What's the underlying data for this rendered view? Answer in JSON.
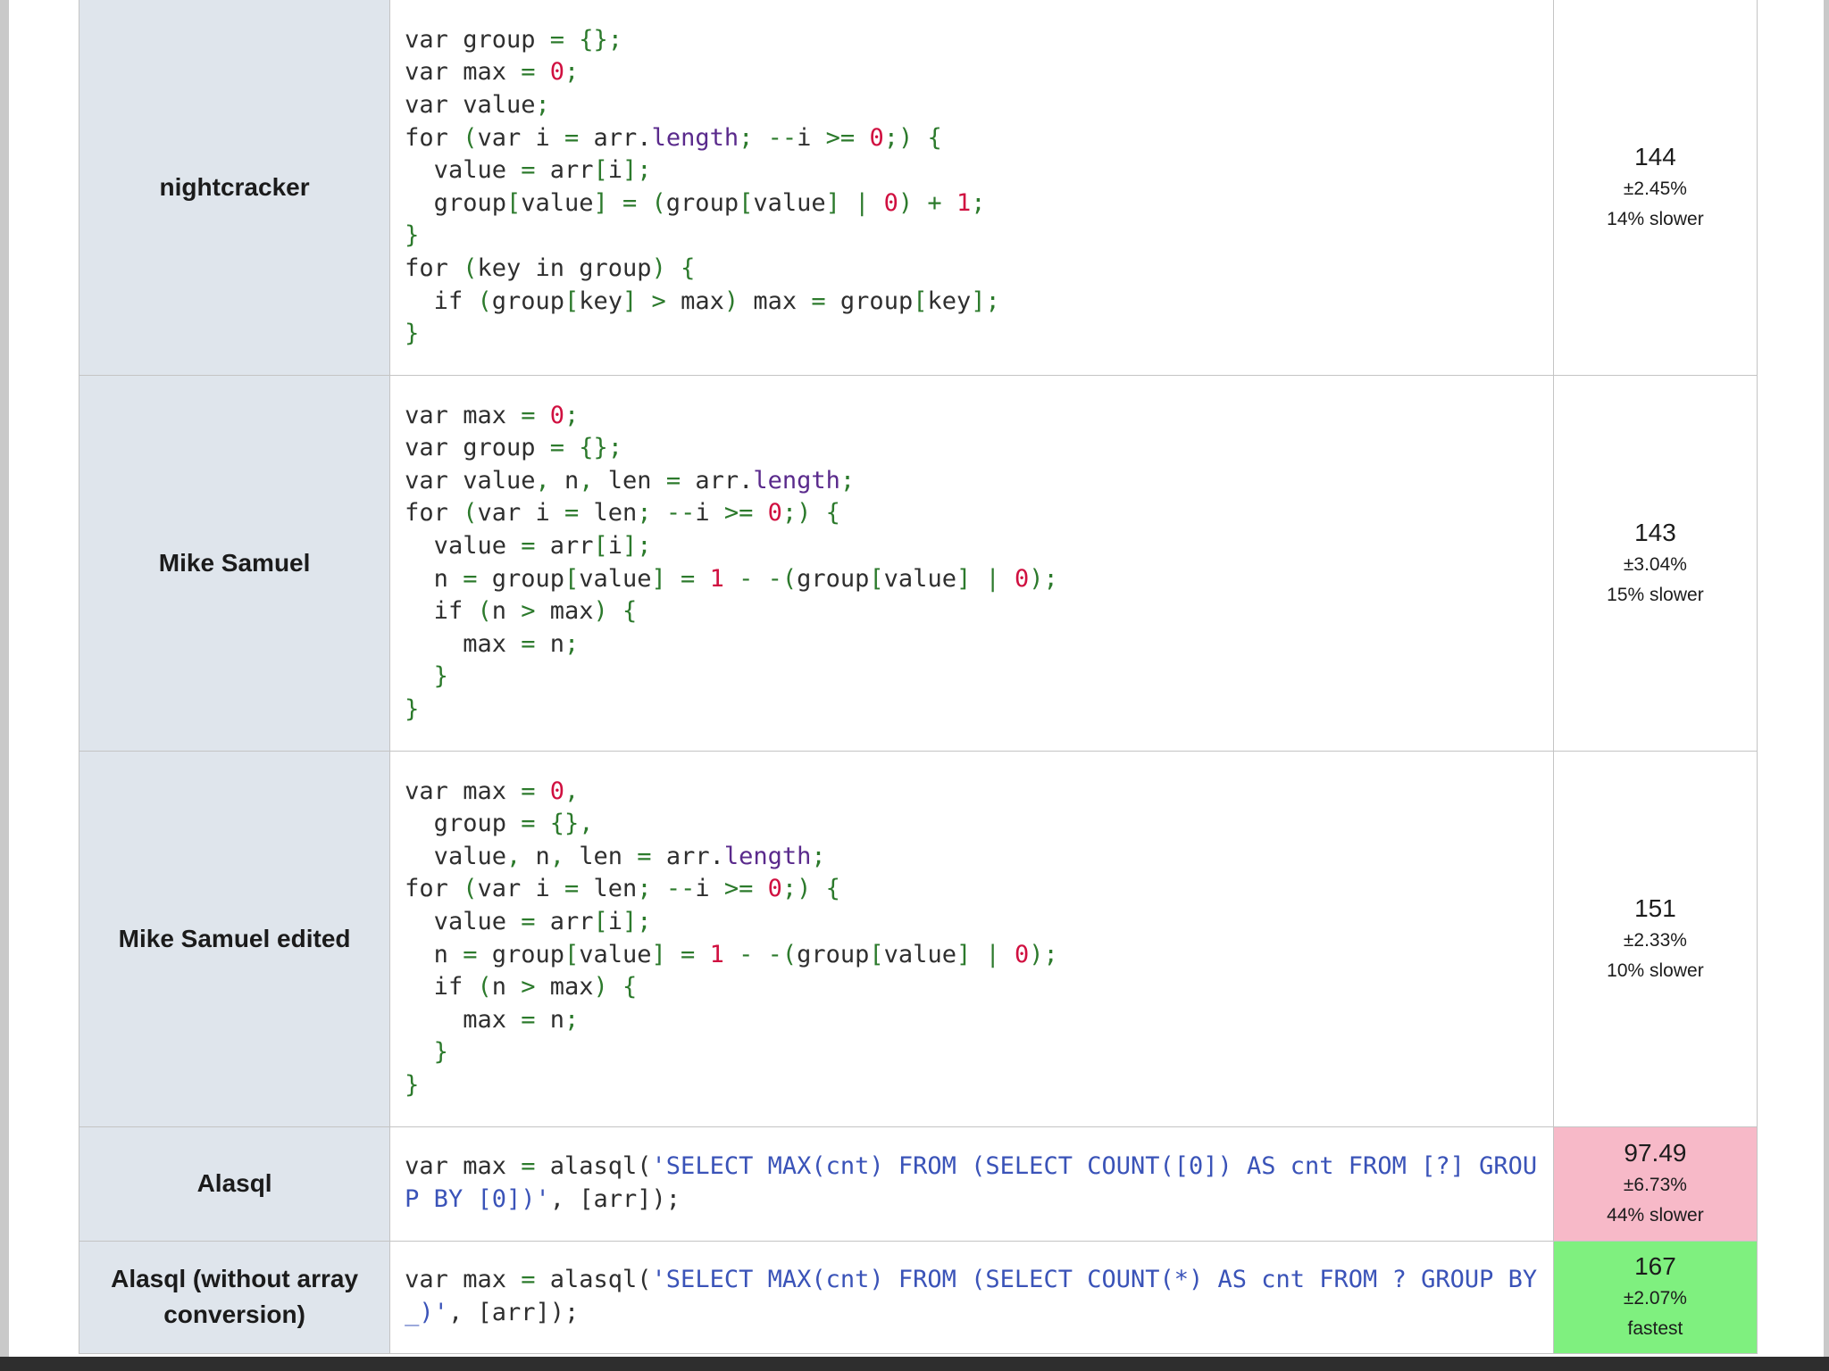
{
  "colors": {
    "name_column_bg": "#dfe5ec",
    "slowest_bg": "#f7b9c8",
    "fastest_bg": "#7ff07f",
    "syntax_punct": "#2c7a2c",
    "syntax_number": "#d01040",
    "syntax_property": "#5a2a8c",
    "syntax_string": "#3a53b8"
  },
  "rows": [
    {
      "name": "nightcracker",
      "code": [
        [
          [
            "k",
            "var "
          ],
          [
            "p",
            "group "
          ],
          [
            "g",
            "= {};"
          ]
        ],
        [
          [
            "k",
            "var "
          ],
          [
            "p",
            "max "
          ],
          [
            "g",
            "= "
          ],
          [
            "r",
            "0"
          ],
          [
            "g",
            ";"
          ]
        ],
        [
          [
            "k",
            "var "
          ],
          [
            "p",
            "value"
          ],
          [
            "g",
            ";"
          ]
        ],
        [
          [
            "k",
            "for "
          ],
          [
            "g",
            "("
          ],
          [
            "k",
            "var "
          ],
          [
            "p",
            "i "
          ],
          [
            "g",
            "= "
          ],
          [
            "p",
            "arr."
          ],
          [
            "pu",
            "length"
          ],
          [
            "g",
            "; --"
          ],
          [
            "p",
            "i "
          ],
          [
            "g",
            ">= "
          ],
          [
            "r",
            "0"
          ],
          [
            "g",
            ";) {"
          ]
        ],
        [
          [
            "p",
            "  value "
          ],
          [
            "g",
            "= "
          ],
          [
            "p",
            "arr"
          ],
          [
            "g",
            "["
          ],
          [
            "p",
            "i"
          ],
          [
            "g",
            "];"
          ]
        ],
        [
          [
            "p",
            "  group"
          ],
          [
            "g",
            "["
          ],
          [
            "p",
            "value"
          ],
          [
            "g",
            "] = ("
          ],
          [
            "p",
            "group"
          ],
          [
            "g",
            "["
          ],
          [
            "p",
            "value"
          ],
          [
            "g",
            "] | "
          ],
          [
            "r",
            "0"
          ],
          [
            "g",
            ") + "
          ],
          [
            "r",
            "1"
          ],
          [
            "g",
            ";"
          ]
        ],
        [
          [
            "g",
            "}"
          ]
        ],
        [
          [
            "k",
            "for "
          ],
          [
            "g",
            "("
          ],
          [
            "p",
            "key "
          ],
          [
            "k",
            "in "
          ],
          [
            "p",
            "group"
          ],
          [
            "g",
            ") {"
          ]
        ],
        [
          [
            "k",
            "  if "
          ],
          [
            "g",
            "("
          ],
          [
            "p",
            "group"
          ],
          [
            "g",
            "["
          ],
          [
            "p",
            "key"
          ],
          [
            "g",
            "] > "
          ],
          [
            "p",
            "max"
          ],
          [
            "g",
            ") "
          ],
          [
            "p",
            "max "
          ],
          [
            "g",
            "= "
          ],
          [
            "p",
            "group"
          ],
          [
            "g",
            "["
          ],
          [
            "p",
            "key"
          ],
          [
            "g",
            "];"
          ]
        ],
        [
          [
            "g",
            "}"
          ]
        ]
      ],
      "ops": "144",
      "rme": "±2.45%",
      "relative": "14% slower",
      "status": "normal"
    },
    {
      "name": "Mike Samuel",
      "code": [
        [
          [
            "k",
            "var "
          ],
          [
            "p",
            "max "
          ],
          [
            "g",
            "= "
          ],
          [
            "r",
            "0"
          ],
          [
            "g",
            ";"
          ]
        ],
        [
          [
            "k",
            "var "
          ],
          [
            "p",
            "group "
          ],
          [
            "g",
            "= {};"
          ]
        ],
        [
          [
            "k",
            "var "
          ],
          [
            "p",
            "value"
          ],
          [
            "g",
            ", "
          ],
          [
            "p",
            "n"
          ],
          [
            "g",
            ", "
          ],
          [
            "p",
            "len "
          ],
          [
            "g",
            "= "
          ],
          [
            "p",
            "arr."
          ],
          [
            "pu",
            "length"
          ],
          [
            "g",
            ";"
          ]
        ],
        [
          [
            "k",
            "for "
          ],
          [
            "g",
            "("
          ],
          [
            "k",
            "var "
          ],
          [
            "p",
            "i "
          ],
          [
            "g",
            "= "
          ],
          [
            "p",
            "len"
          ],
          [
            "g",
            "; --"
          ],
          [
            "p",
            "i "
          ],
          [
            "g",
            ">= "
          ],
          [
            "r",
            "0"
          ],
          [
            "g",
            ";) {"
          ]
        ],
        [
          [
            "p",
            "  value "
          ],
          [
            "g",
            "= "
          ],
          [
            "p",
            "arr"
          ],
          [
            "g",
            "["
          ],
          [
            "p",
            "i"
          ],
          [
            "g",
            "];"
          ]
        ],
        [
          [
            "p",
            "  n "
          ],
          [
            "g",
            "= "
          ],
          [
            "p",
            "group"
          ],
          [
            "g",
            "["
          ],
          [
            "p",
            "value"
          ],
          [
            "g",
            "] = "
          ],
          [
            "r",
            "1 "
          ],
          [
            "g",
            "- -("
          ],
          [
            "p",
            "group"
          ],
          [
            "g",
            "["
          ],
          [
            "p",
            "value"
          ],
          [
            "g",
            "] | "
          ],
          [
            "r",
            "0"
          ],
          [
            "g",
            ");"
          ]
        ],
        [
          [
            "k",
            "  if "
          ],
          [
            "g",
            "("
          ],
          [
            "p",
            "n "
          ],
          [
            "g",
            "> "
          ],
          [
            "p",
            "max"
          ],
          [
            "g",
            ") {"
          ]
        ],
        [
          [
            "p",
            "    max "
          ],
          [
            "g",
            "= "
          ],
          [
            "p",
            "n"
          ],
          [
            "g",
            ";"
          ]
        ],
        [
          [
            "g",
            "  }"
          ]
        ],
        [
          [
            "g",
            "}"
          ]
        ]
      ],
      "ops": "143",
      "rme": "±3.04%",
      "relative": "15% slower",
      "status": "normal"
    },
    {
      "name": "Mike Samuel edited",
      "code": [
        [
          [
            "k",
            "var "
          ],
          [
            "p",
            "max "
          ],
          [
            "g",
            "= "
          ],
          [
            "r",
            "0"
          ],
          [
            "g",
            ","
          ]
        ],
        [
          [
            "p",
            "  group "
          ],
          [
            "g",
            "= {},"
          ]
        ],
        [
          [
            "p",
            "  value"
          ],
          [
            "g",
            ", "
          ],
          [
            "p",
            "n"
          ],
          [
            "g",
            ", "
          ],
          [
            "p",
            "len "
          ],
          [
            "g",
            "= "
          ],
          [
            "p",
            "arr."
          ],
          [
            "pu",
            "length"
          ],
          [
            "g",
            ";"
          ]
        ],
        [
          [
            "k",
            "for "
          ],
          [
            "g",
            "("
          ],
          [
            "k",
            "var "
          ],
          [
            "p",
            "i "
          ],
          [
            "g",
            "= "
          ],
          [
            "p",
            "len"
          ],
          [
            "g",
            "; --"
          ],
          [
            "p",
            "i "
          ],
          [
            "g",
            ">= "
          ],
          [
            "r",
            "0"
          ],
          [
            "g",
            ";) {"
          ]
        ],
        [
          [
            "p",
            "  value "
          ],
          [
            "g",
            "= "
          ],
          [
            "p",
            "arr"
          ],
          [
            "g",
            "["
          ],
          [
            "p",
            "i"
          ],
          [
            "g",
            "];"
          ]
        ],
        [
          [
            "p",
            "  n "
          ],
          [
            "g",
            "= "
          ],
          [
            "p",
            "group"
          ],
          [
            "g",
            "["
          ],
          [
            "p",
            "value"
          ],
          [
            "g",
            "] = "
          ],
          [
            "r",
            "1 "
          ],
          [
            "g",
            "- -("
          ],
          [
            "p",
            "group"
          ],
          [
            "g",
            "["
          ],
          [
            "p",
            "value"
          ],
          [
            "g",
            "] | "
          ],
          [
            "r",
            "0"
          ],
          [
            "g",
            ");"
          ]
        ],
        [
          [
            "k",
            "  if "
          ],
          [
            "g",
            "("
          ],
          [
            "p",
            "n "
          ],
          [
            "g",
            "> "
          ],
          [
            "p",
            "max"
          ],
          [
            "g",
            ") {"
          ]
        ],
        [
          [
            "p",
            "    max "
          ],
          [
            "g",
            "= "
          ],
          [
            "p",
            "n"
          ],
          [
            "g",
            ";"
          ]
        ],
        [
          [
            "g",
            "  }"
          ]
        ],
        [
          [
            "g",
            "}"
          ]
        ]
      ],
      "ops": "151",
      "rme": "±2.33%",
      "relative": "10% slower",
      "status": "normal"
    },
    {
      "name": "Alasql",
      "wrap": true,
      "code": [
        [
          [
            "k",
            "var "
          ],
          [
            "p",
            "max "
          ],
          [
            "g",
            "= "
          ],
          [
            "p",
            "alasql("
          ],
          [
            "b",
            "'SELECT MAX(cnt) FROM (SELECT COUNT([0]) AS cnt FROM [?] GROUP BY [0])'"
          ],
          [
            "p",
            ", [arr]);"
          ]
        ]
      ],
      "ops": "97.49",
      "rme": "±6.73%",
      "relative": "44% slower",
      "status": "slowest"
    },
    {
      "name": "Alasql (without array conversion)",
      "wrap": true,
      "code": [
        [
          [
            "k",
            "var "
          ],
          [
            "p",
            "max "
          ],
          [
            "g",
            "= "
          ],
          [
            "p",
            "alasql("
          ],
          [
            "b",
            "'SELECT MAX(cnt) FROM (SELECT COUNT(*) AS cnt FROM ? GROUP BY _)'"
          ],
          [
            "p",
            ", [arr]);"
          ]
        ]
      ],
      "ops": "167",
      "rme": "±2.07%",
      "relative": "fastest",
      "status": "fastest"
    }
  ]
}
